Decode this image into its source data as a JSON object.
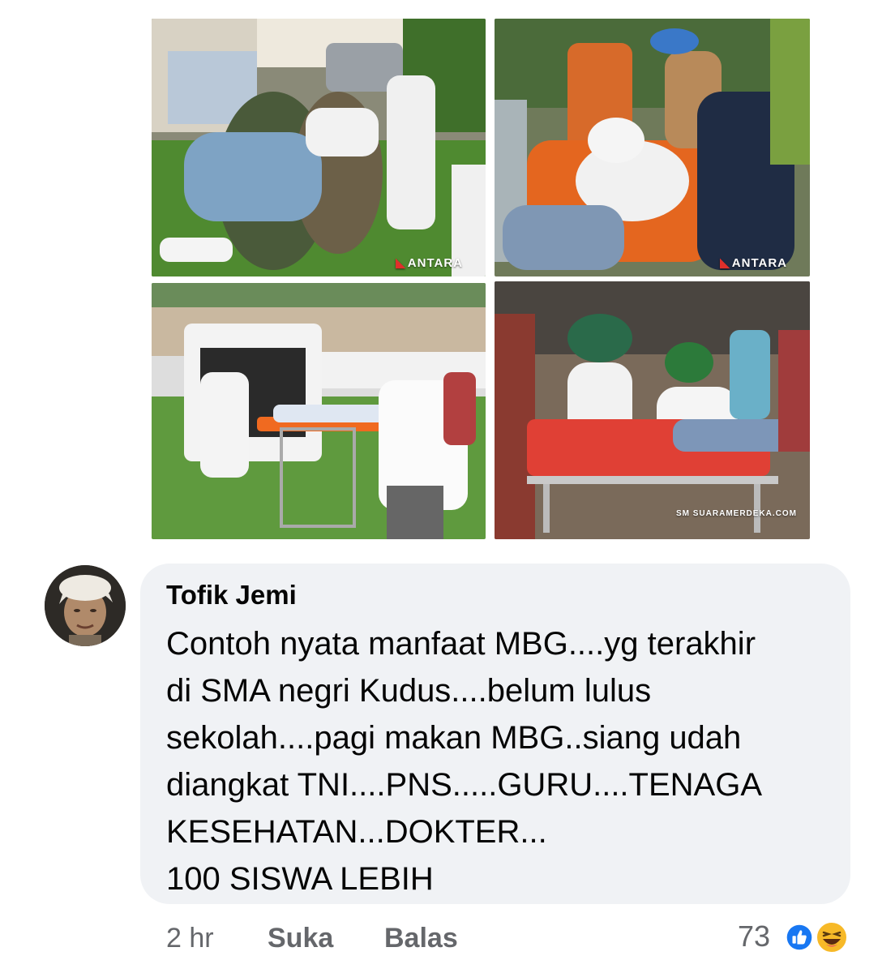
{
  "photos": {
    "top_left": {
      "watermark": "ANTARA"
    },
    "top_right": {
      "watermark": "ANTARA"
    },
    "bottom_left": {
      "watermark": ""
    },
    "bottom_right": {
      "watermark": "SUARAMERDEKA.COM"
    }
  },
  "comment": {
    "author": "Tofik Jemi",
    "lines": [
      "Contoh nyata manfaat MBG....yg terakhir",
      "di SMA negri Kudus....belum lulus",
      "sekolah....pagi makan MBG..siang udah",
      "diangkat TNI....PNS.....GURU....TENAGA",
      "KESEHATAN...DOKTER...",
      "100 SISWA LEBIH"
    ],
    "time": "2 hr",
    "like_label": "Suka",
    "reply_label": "Balas",
    "reaction_count": "73",
    "reactions": [
      "like-icon",
      "haha-icon"
    ]
  },
  "colors": {
    "bubble": "#f0f2f5",
    "like_blue": "#1877f2",
    "haha_yellow": "#f7b928"
  }
}
